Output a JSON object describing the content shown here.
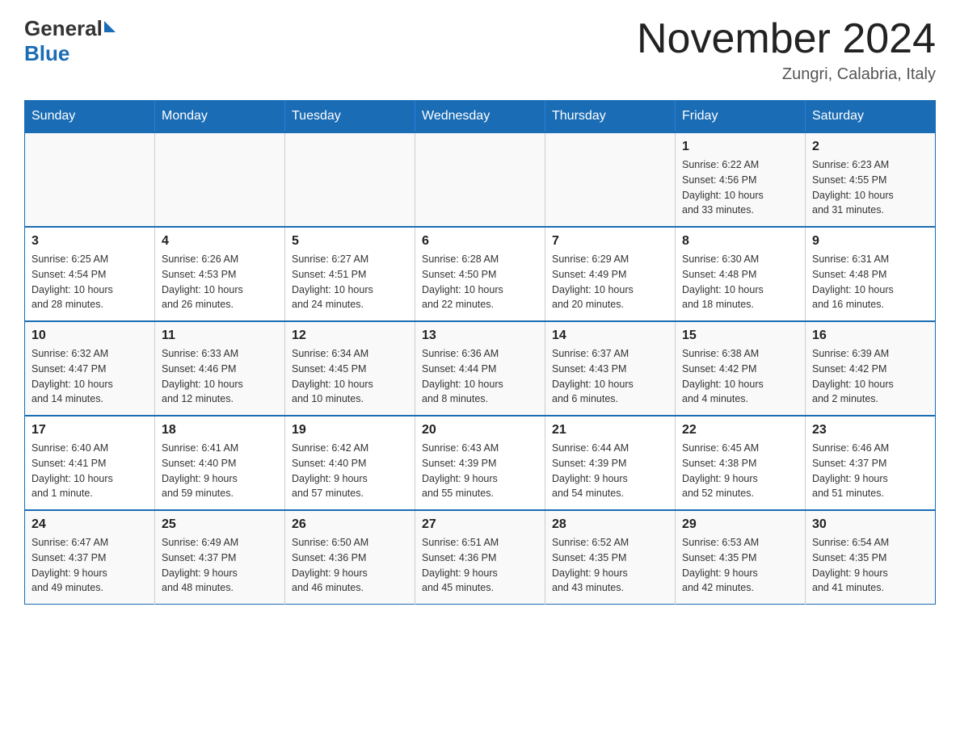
{
  "header": {
    "logo_general": "General",
    "logo_blue": "Blue",
    "month_title": "November 2024",
    "location": "Zungri, Calabria, Italy"
  },
  "days_of_week": [
    "Sunday",
    "Monday",
    "Tuesday",
    "Wednesday",
    "Thursday",
    "Friday",
    "Saturday"
  ],
  "weeks": [
    [
      {
        "day": "",
        "info": ""
      },
      {
        "day": "",
        "info": ""
      },
      {
        "day": "",
        "info": ""
      },
      {
        "day": "",
        "info": ""
      },
      {
        "day": "",
        "info": ""
      },
      {
        "day": "1",
        "info": "Sunrise: 6:22 AM\nSunset: 4:56 PM\nDaylight: 10 hours\nand 33 minutes."
      },
      {
        "day": "2",
        "info": "Sunrise: 6:23 AM\nSunset: 4:55 PM\nDaylight: 10 hours\nand 31 minutes."
      }
    ],
    [
      {
        "day": "3",
        "info": "Sunrise: 6:25 AM\nSunset: 4:54 PM\nDaylight: 10 hours\nand 28 minutes."
      },
      {
        "day": "4",
        "info": "Sunrise: 6:26 AM\nSunset: 4:53 PM\nDaylight: 10 hours\nand 26 minutes."
      },
      {
        "day": "5",
        "info": "Sunrise: 6:27 AM\nSunset: 4:51 PM\nDaylight: 10 hours\nand 24 minutes."
      },
      {
        "day": "6",
        "info": "Sunrise: 6:28 AM\nSunset: 4:50 PM\nDaylight: 10 hours\nand 22 minutes."
      },
      {
        "day": "7",
        "info": "Sunrise: 6:29 AM\nSunset: 4:49 PM\nDaylight: 10 hours\nand 20 minutes."
      },
      {
        "day": "8",
        "info": "Sunrise: 6:30 AM\nSunset: 4:48 PM\nDaylight: 10 hours\nand 18 minutes."
      },
      {
        "day": "9",
        "info": "Sunrise: 6:31 AM\nSunset: 4:48 PM\nDaylight: 10 hours\nand 16 minutes."
      }
    ],
    [
      {
        "day": "10",
        "info": "Sunrise: 6:32 AM\nSunset: 4:47 PM\nDaylight: 10 hours\nand 14 minutes."
      },
      {
        "day": "11",
        "info": "Sunrise: 6:33 AM\nSunset: 4:46 PM\nDaylight: 10 hours\nand 12 minutes."
      },
      {
        "day": "12",
        "info": "Sunrise: 6:34 AM\nSunset: 4:45 PM\nDaylight: 10 hours\nand 10 minutes."
      },
      {
        "day": "13",
        "info": "Sunrise: 6:36 AM\nSunset: 4:44 PM\nDaylight: 10 hours\nand 8 minutes."
      },
      {
        "day": "14",
        "info": "Sunrise: 6:37 AM\nSunset: 4:43 PM\nDaylight: 10 hours\nand 6 minutes."
      },
      {
        "day": "15",
        "info": "Sunrise: 6:38 AM\nSunset: 4:42 PM\nDaylight: 10 hours\nand 4 minutes."
      },
      {
        "day": "16",
        "info": "Sunrise: 6:39 AM\nSunset: 4:42 PM\nDaylight: 10 hours\nand 2 minutes."
      }
    ],
    [
      {
        "day": "17",
        "info": "Sunrise: 6:40 AM\nSunset: 4:41 PM\nDaylight: 10 hours\nand 1 minute."
      },
      {
        "day": "18",
        "info": "Sunrise: 6:41 AM\nSunset: 4:40 PM\nDaylight: 9 hours\nand 59 minutes."
      },
      {
        "day": "19",
        "info": "Sunrise: 6:42 AM\nSunset: 4:40 PM\nDaylight: 9 hours\nand 57 minutes."
      },
      {
        "day": "20",
        "info": "Sunrise: 6:43 AM\nSunset: 4:39 PM\nDaylight: 9 hours\nand 55 minutes."
      },
      {
        "day": "21",
        "info": "Sunrise: 6:44 AM\nSunset: 4:39 PM\nDaylight: 9 hours\nand 54 minutes."
      },
      {
        "day": "22",
        "info": "Sunrise: 6:45 AM\nSunset: 4:38 PM\nDaylight: 9 hours\nand 52 minutes."
      },
      {
        "day": "23",
        "info": "Sunrise: 6:46 AM\nSunset: 4:37 PM\nDaylight: 9 hours\nand 51 minutes."
      }
    ],
    [
      {
        "day": "24",
        "info": "Sunrise: 6:47 AM\nSunset: 4:37 PM\nDaylight: 9 hours\nand 49 minutes."
      },
      {
        "day": "25",
        "info": "Sunrise: 6:49 AM\nSunset: 4:37 PM\nDaylight: 9 hours\nand 48 minutes."
      },
      {
        "day": "26",
        "info": "Sunrise: 6:50 AM\nSunset: 4:36 PM\nDaylight: 9 hours\nand 46 minutes."
      },
      {
        "day": "27",
        "info": "Sunrise: 6:51 AM\nSunset: 4:36 PM\nDaylight: 9 hours\nand 45 minutes."
      },
      {
        "day": "28",
        "info": "Sunrise: 6:52 AM\nSunset: 4:35 PM\nDaylight: 9 hours\nand 43 minutes."
      },
      {
        "day": "29",
        "info": "Sunrise: 6:53 AM\nSunset: 4:35 PM\nDaylight: 9 hours\nand 42 minutes."
      },
      {
        "day": "30",
        "info": "Sunrise: 6:54 AM\nSunset: 4:35 PM\nDaylight: 9 hours\nand 41 minutes."
      }
    ]
  ]
}
